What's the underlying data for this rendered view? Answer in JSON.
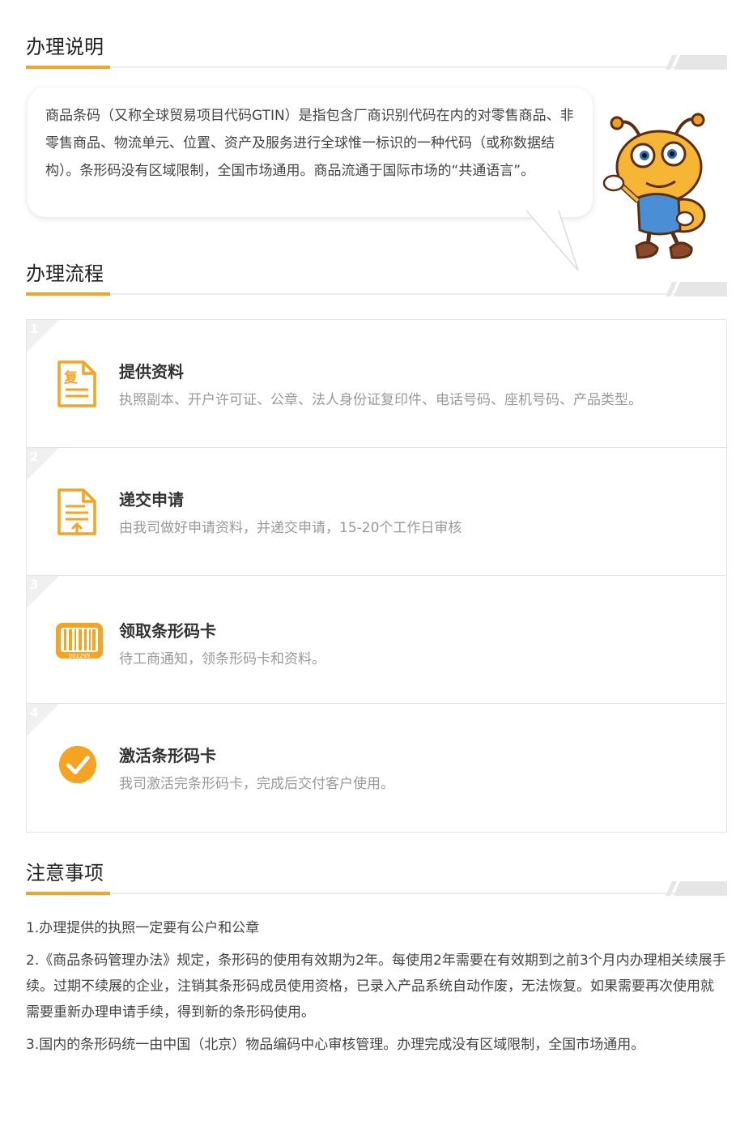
{
  "sections": {
    "instructions_title": "办理说明",
    "process_title": "办理流程",
    "notes_title": "注意事项"
  },
  "intro": {
    "text": "商品条码（又称全球贸易项目代码GTIN）是指包含厂商识别代码在内的对零售商品、非零售商品、物流单元、位置、资产及服务进行全球惟一标识的一种代码（或称数据结构）。条形码没有区域限制，全国市场通用。商品流通于国际市场的“共通语言”。"
  },
  "steps": [
    {
      "num": "1",
      "title": "提供资料",
      "desc": "执照副本、开户许可证、公章、法人身份证复印件、电话号码、座机号码、产品类型。",
      "icon": "document-copy-icon",
      "icon_char": "复"
    },
    {
      "num": "2",
      "title": "递交申请",
      "desc": "由我司做好申请资料，并递交申请，15-20个工作日审核",
      "icon": "document-upload-icon"
    },
    {
      "num": "3",
      "title": "领取条形码卡",
      "desc": "待工商通知，领条形码卡和资料。",
      "icon": "barcode-card-icon",
      "barcode_text": "001295"
    },
    {
      "num": "4",
      "title": "激活条形码卡",
      "desc": "我司激活完条形码卡，完成后交付客户使用。",
      "icon": "check-circle-icon"
    }
  ],
  "notes": [
    "1.办理提供的执照一定要有公户和公章",
    "2.《商品条码管理办法》规定，条形码的使用有效期为2年。每使用2年需要在有效期到之前3个月内办理相关续展手续。过期不续展的企业，注销其条形码成员使用资格，已录入产品系统自动作废，无法恢复。如果需要再次使用就需要重新办理申请手续，得到新的条形码使用。",
    "3.国内的条形码统一由中国（北京）物品编码中心审核管理。办理完成没有区域限制，全国市场通用。"
  ],
  "colors": {
    "accent": "#f6a321",
    "step_corner": "#f0f0f0",
    "text_muted": "#999999"
  }
}
